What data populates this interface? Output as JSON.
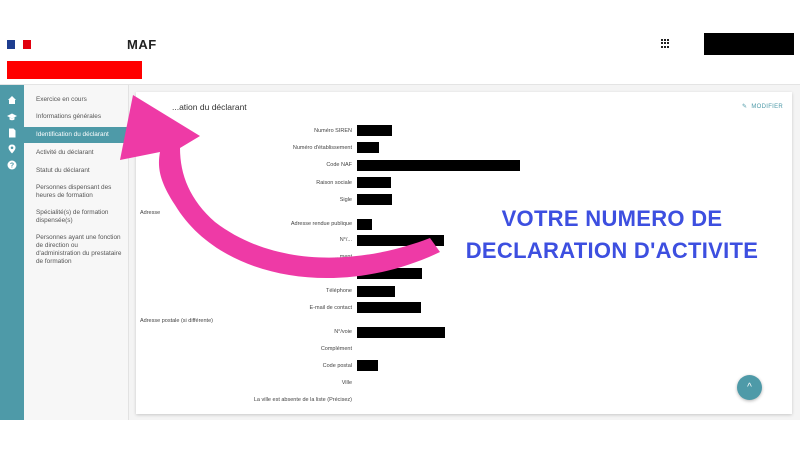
{
  "header": {
    "app_title": "MAF",
    "flag_colors": [
      "#1e3d8f",
      "#ffffff",
      "#e1000f"
    ],
    "apps_icon": "grid-icon"
  },
  "nav_icons": [
    "home-icon",
    "graduation-cap-icon",
    "document-icon",
    "location-pin-icon",
    "help-icon"
  ],
  "sidebar": {
    "items": [
      {
        "label": "Exercice en cours"
      },
      {
        "label": "Informations générales"
      },
      {
        "label": "Identification du déclarant"
      },
      {
        "label": "Activité du déclarant"
      },
      {
        "label": "Statut du déclarant"
      },
      {
        "label": "Personnes dispensant des heures de formation"
      },
      {
        "label": "Spécialité(s) de formation dispensée(s)"
      },
      {
        "label": "Personnes ayant une fonction de direction ou d'administration du prestataire de formation"
      }
    ]
  },
  "card": {
    "title": "...ation du déclarant",
    "modify_label": "MODIFIER",
    "fields": [
      {
        "label": "Numéro SIREN"
      },
      {
        "label": "Numéro d'établissement"
      },
      {
        "label": "Code NAF"
      },
      {
        "label": "Raison sociale"
      },
      {
        "label": "Sigle"
      },
      {
        "label": "Adresse rendue publique"
      },
      {
        "label": "N°/..."
      },
      {
        "label": "...ment"
      },
      {
        "label": "...ou Code Postal"
      },
      {
        "label": "Téléphone"
      },
      {
        "label": "E-mail de contact"
      },
      {
        "label": "N°/voie"
      },
      {
        "label": "Complément"
      },
      {
        "label": "Code postal"
      },
      {
        "label": "Ville"
      },
      {
        "label": "La ville est absente de la liste (Précisez)"
      }
    ],
    "section_address": "Adresse",
    "section_postal": "Adresse postale (si différente)"
  },
  "annotation": {
    "line1": "VOTRE NUMERO DE",
    "line2": "DECLARATION D'ACTIVITE",
    "color": "#3d4fe0",
    "arrow_color": "#ee3aa6"
  },
  "accent_color": "#4e9aa8"
}
